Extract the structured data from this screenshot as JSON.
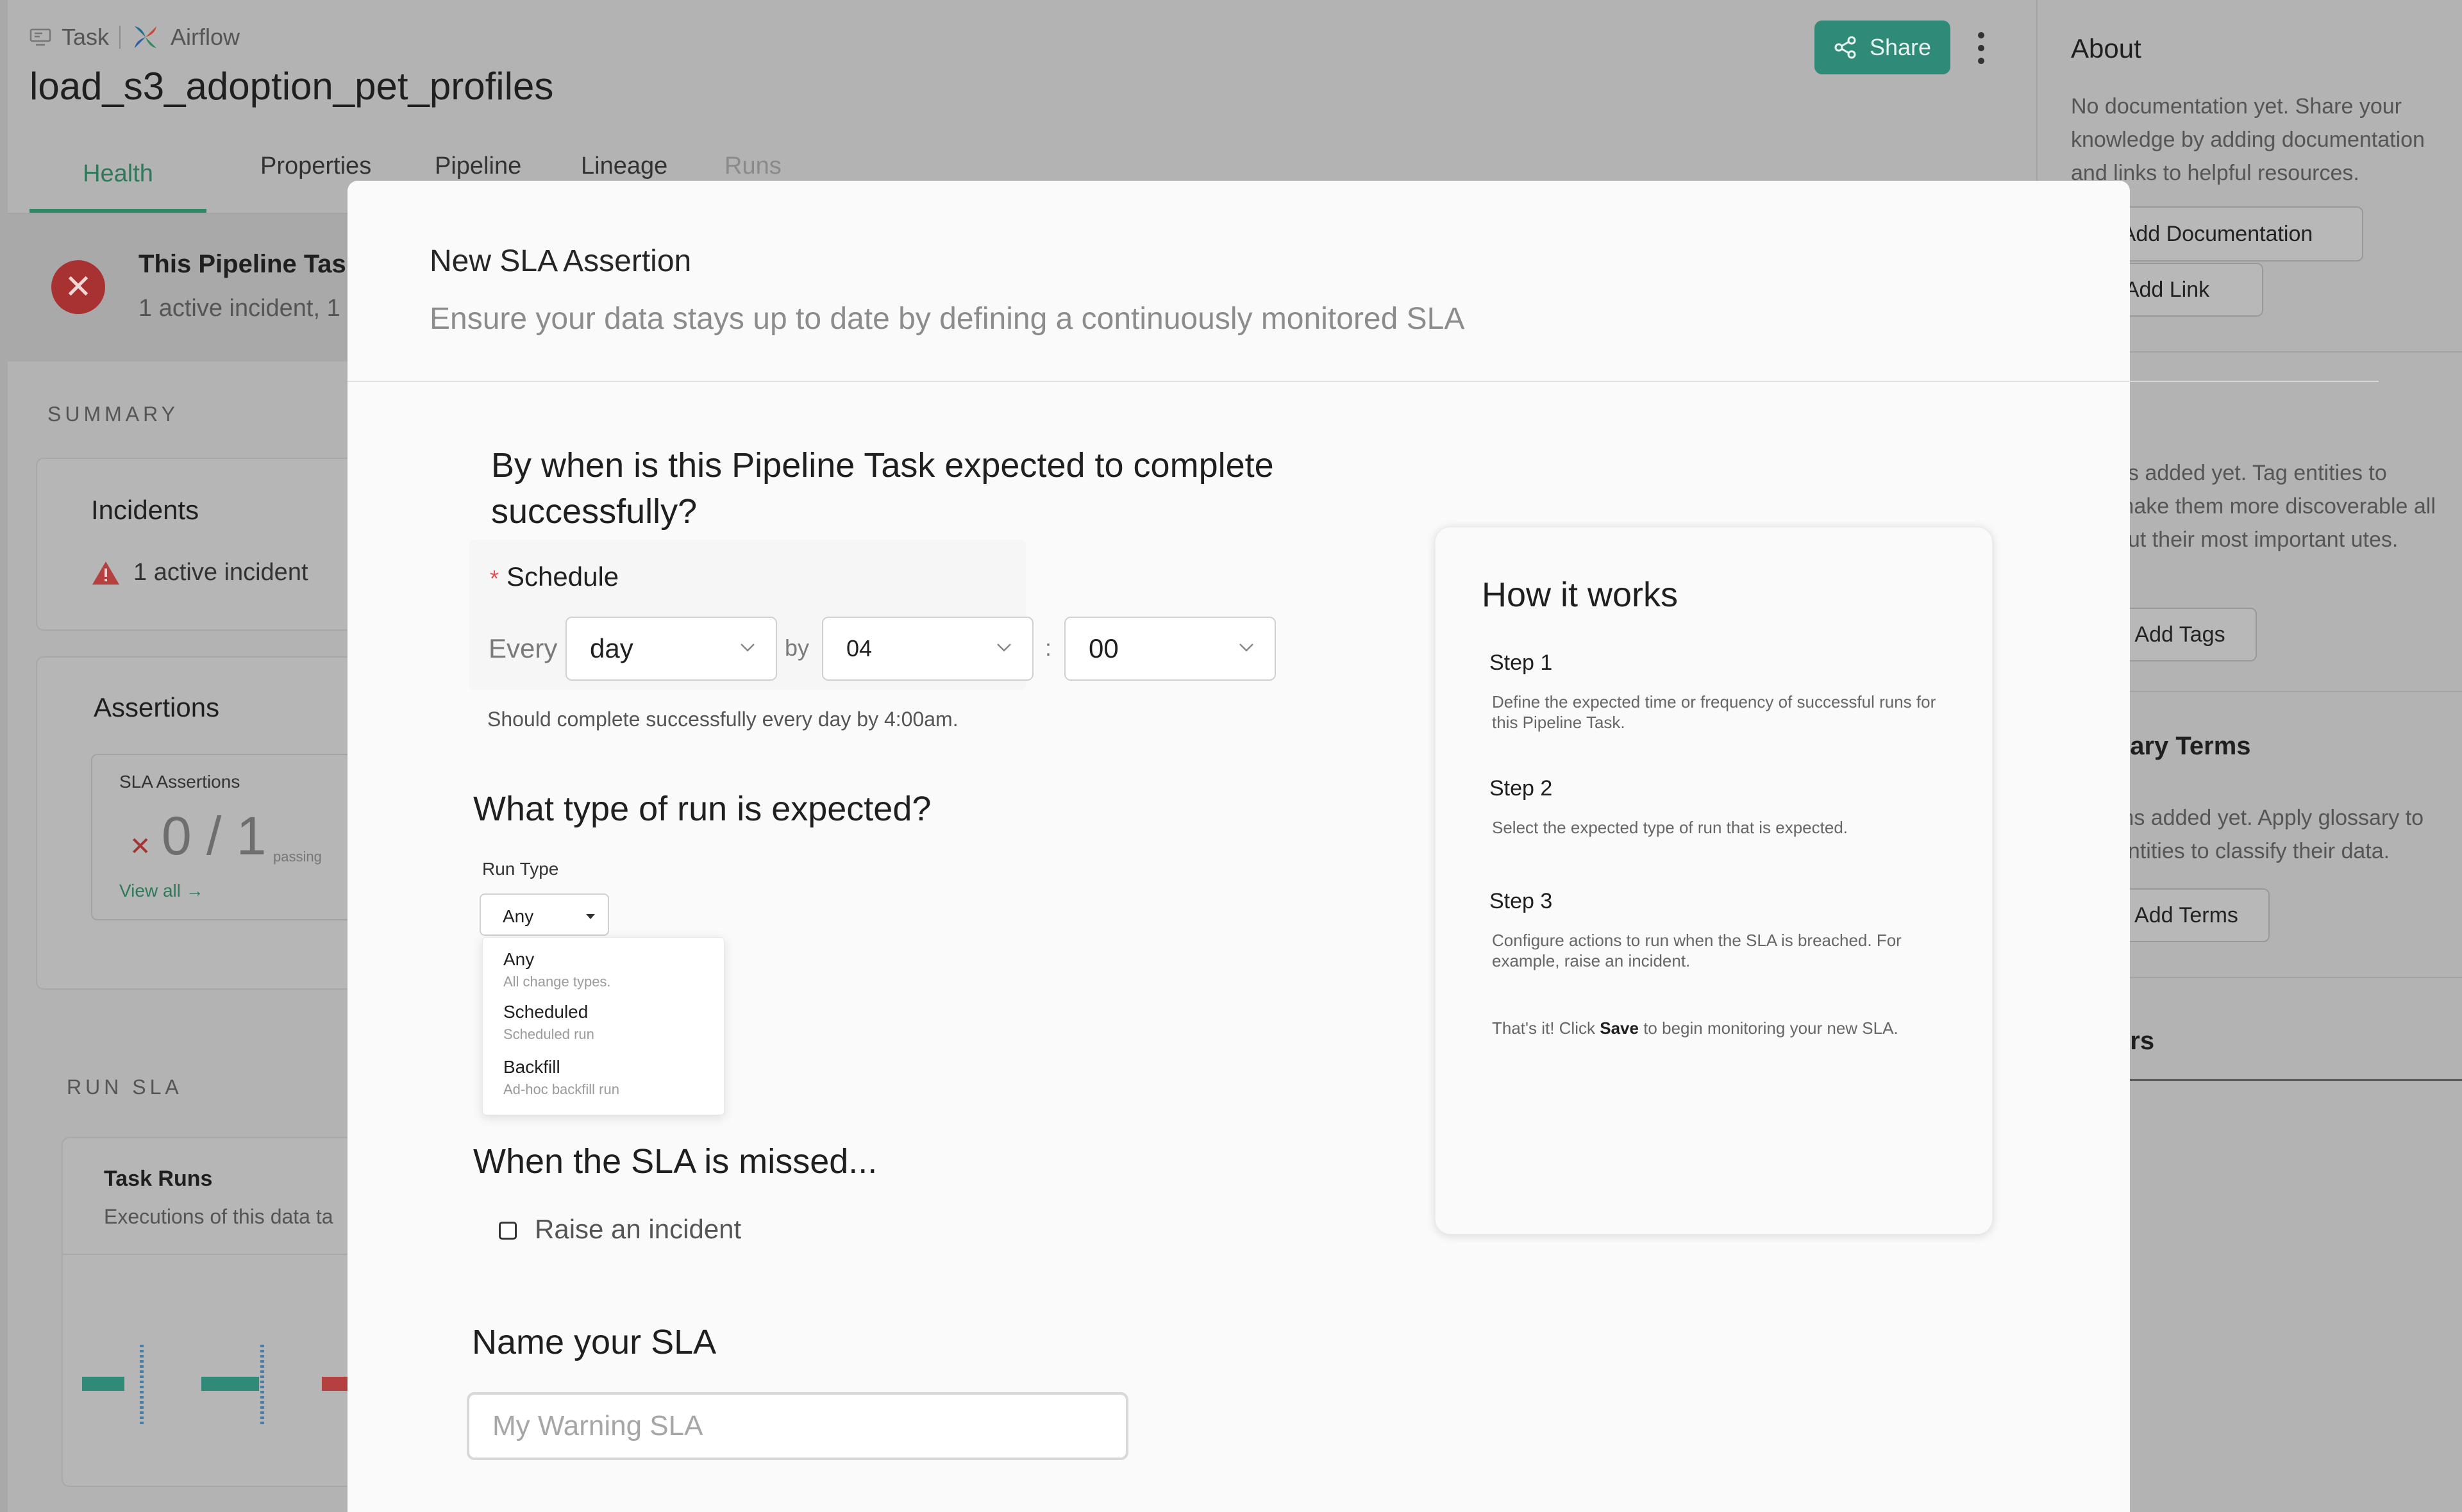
{
  "page": {
    "entity_type": "Task",
    "platform": "Airflow",
    "title": "load_s3_adoption_pet_profiles",
    "share_label": "Share",
    "tabs": [
      {
        "label": "Health"
      },
      {
        "label": "Properties"
      },
      {
        "label": "Pipeline"
      },
      {
        "label": "Lineage"
      },
      {
        "label": "Runs"
      }
    ],
    "banner": {
      "title": "This Pipeline Task",
      "subtitle": "1 active incident, 1"
    },
    "summary_label": "SUMMARY",
    "incidents": {
      "title": "Incidents",
      "text_count": "1",
      "text_rest": "active incident"
    },
    "assertions": {
      "title": "Assertions",
      "sla_label": "SLA Assertions",
      "passing_value": "0 / 1",
      "passing_label": "passing",
      "view_all": "View all →"
    },
    "run_sla_label": "RUN SLA",
    "task_runs": {
      "title": "Task Runs",
      "subtitle": "Executions of this data ta"
    }
  },
  "sidebar": {
    "about_title": "About",
    "about_text": "No documentation yet. Share your knowledge by adding documentation and links to helpful resources.",
    "add_documentation": "Add Documentation",
    "add_link": "Add Link",
    "tags_text": "gs added yet. Tag entities to make them more discoverable all out their most important utes.",
    "add_tags": "Add Tags",
    "glossary_title": "sary Terms",
    "glossary_text": "ms added yet. Apply glossary to entities to classify their data.",
    "add_terms": "Add Terms",
    "owners_title": "ers"
  },
  "modal": {
    "title": "New SLA Assertion",
    "subtitle": "Ensure your data stays up to date by defining a continuously monitored SLA",
    "q1_line1": "By when is this Pipeline Task expected to complete",
    "q1_line2": "successfully?",
    "schedule_label": "Schedule",
    "required_mark": "*",
    "every_label": "Every",
    "frequency_value": "day",
    "by_label": "by",
    "hour_value": "04",
    "colon": ":",
    "minute_value": "00",
    "schedule_hint": "Should complete successfully every day by 4:00am.",
    "q2": "What type of run is expected?",
    "run_type_label": "Run Type",
    "run_type_value": "Any",
    "run_type_options": [
      {
        "title": "Any",
        "desc": "All change types."
      },
      {
        "title": "Scheduled",
        "desc": "Scheduled run"
      },
      {
        "title": "Backfill",
        "desc": "Ad-hoc backfill run"
      }
    ],
    "q3": "When the SLA is missed...",
    "raise_incident_label": "Raise an incident",
    "raise_incident_checked": false,
    "q4": "Name your SLA",
    "name_placeholder": "My Warning SLA",
    "name_value": ""
  },
  "how_it_works": {
    "title": "How it works",
    "steps": [
      {
        "title": "Step 1",
        "desc": "Define the expected time or frequency of successful runs for this Pipeline Task."
      },
      {
        "title": "Step 2",
        "desc": "Select the expected type of run that is expected."
      },
      {
        "title": "Step 3",
        "desc": "Configure actions to run when the SLA is breached. For example, raise an incident."
      }
    ],
    "final_prefix": "That's it! Click",
    "final_bold": "Save",
    "final_suffix": "to begin monitoring your new SLA."
  },
  "colors": {
    "accent_green": "#2f8a78",
    "error_red": "#a83232",
    "overlay_gray": "#b3b3b3"
  }
}
